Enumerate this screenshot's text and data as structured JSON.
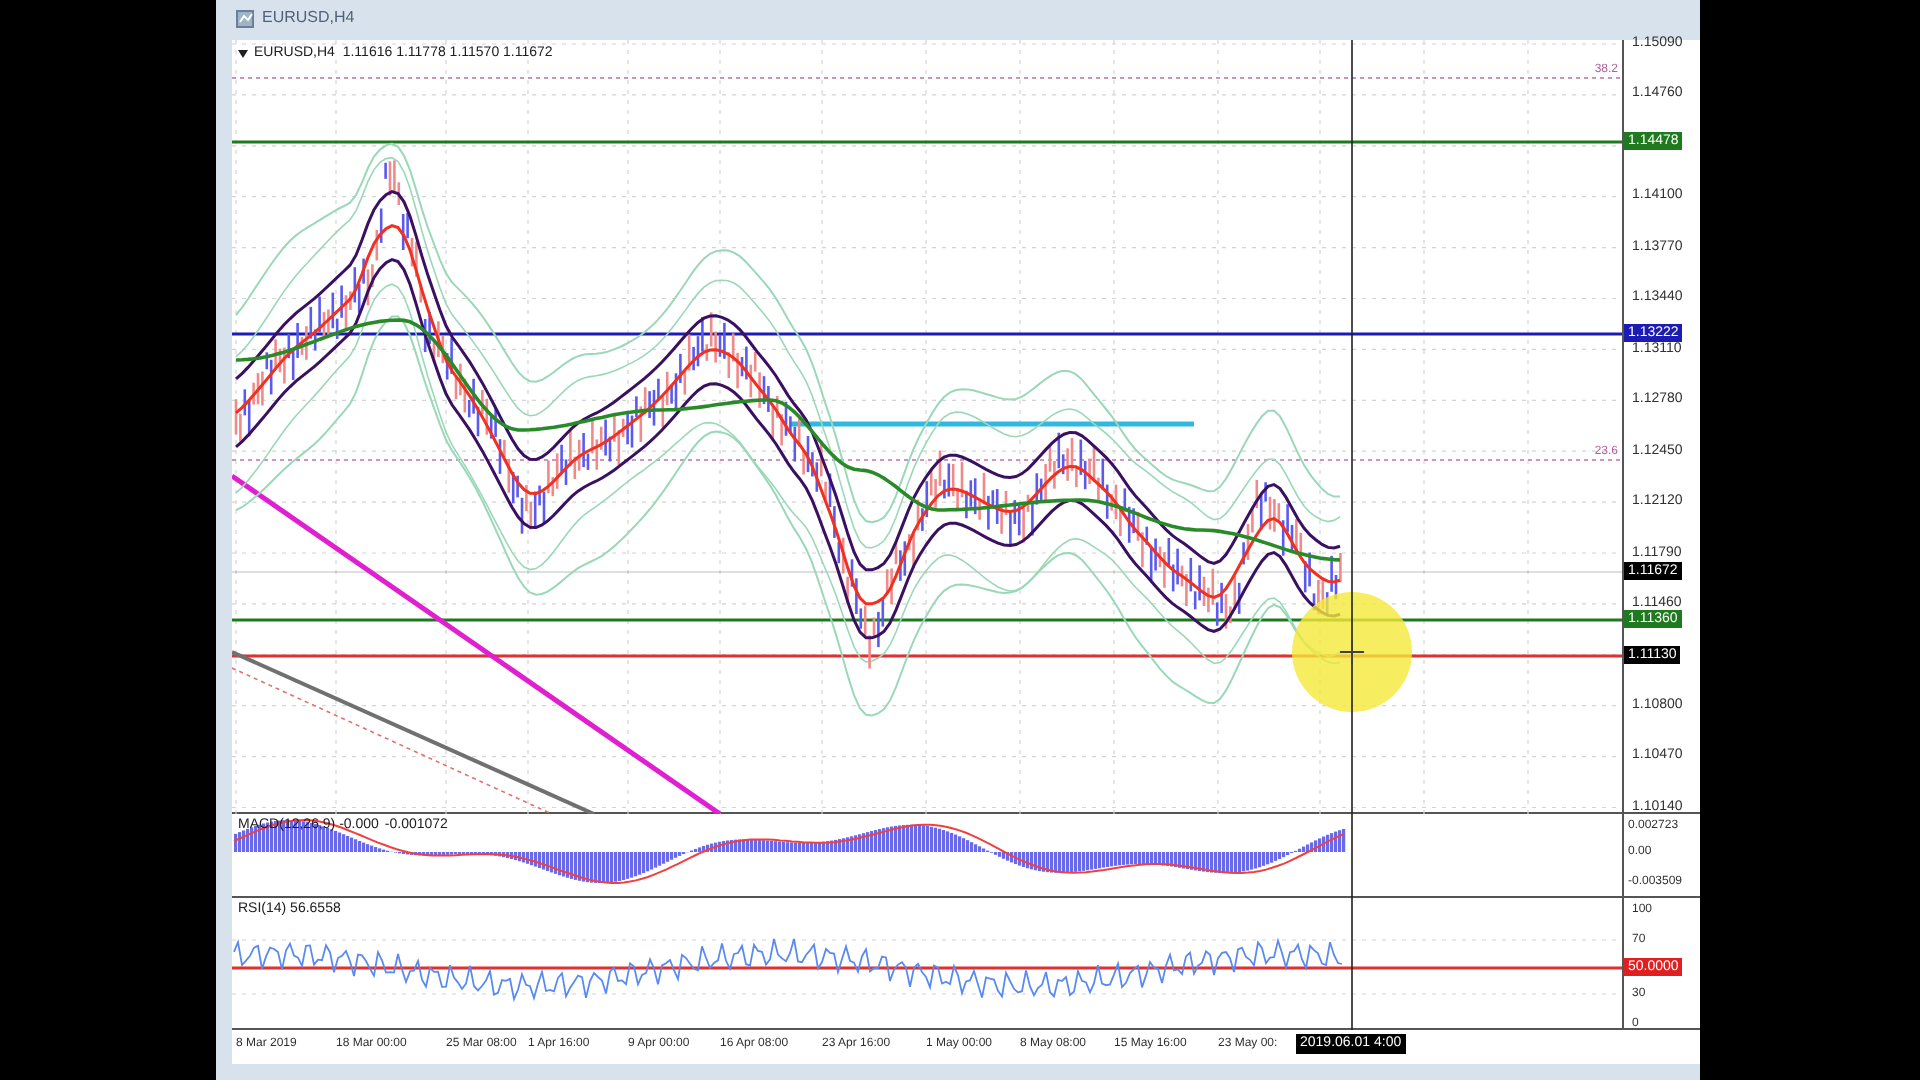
{
  "window": {
    "title": "EURUSD,H4"
  },
  "chart": {
    "header": "EURUSD,H4  1.11616 1.11778 1.11570 1.11672",
    "price_axis": [
      "1.15090",
      "1.14760",
      "1.14100",
      "1.13770",
      "1.13440",
      "1.13110",
      "1.12780",
      "1.12450",
      "1.12120",
      "1.11790",
      "1.11460",
      "1.10800",
      "1.10470",
      "1.10140"
    ],
    "levels": [
      {
        "label": "1.14478",
        "color": "#1f7a1f",
        "kind": "level"
      },
      {
        "label": "1.13222",
        "color": "#1c1cb4",
        "kind": "level"
      },
      {
        "label": "1.11672",
        "color": "#000000",
        "kind": "bid"
      },
      {
        "label": "1.11360",
        "color": "#1f7a1f",
        "kind": "level"
      },
      {
        "label": "1.11130",
        "color": "#000000",
        "kind": "alert"
      }
    ],
    "fib_labels": [
      "38.2",
      "23.6"
    ]
  },
  "macd": {
    "label": "MACD(12,26,9) -0.000",
    "label_2": "-0.001072",
    "axis": [
      "0.002723",
      "0.00",
      "-0.003509"
    ]
  },
  "rsi": {
    "label": "RSI(14) 56.6558",
    "axis": [
      "100",
      "70",
      "30",
      "0"
    ],
    "level_label": "50.0000"
  },
  "time_axis": {
    "labels": [
      "8 Mar 2019",
      "18 Mar 00:00",
      "25 Mar 08:00",
      "1 Apr 16:00",
      "9 Apr 00:00",
      "16 Apr 08:00",
      "23 Apr 16:00",
      "1 May 00:00",
      "8 May 08:00",
      "15 May 16:00",
      "23 May 00:"
    ],
    "cursor_time": "2019.06.01 4:00"
  }
}
